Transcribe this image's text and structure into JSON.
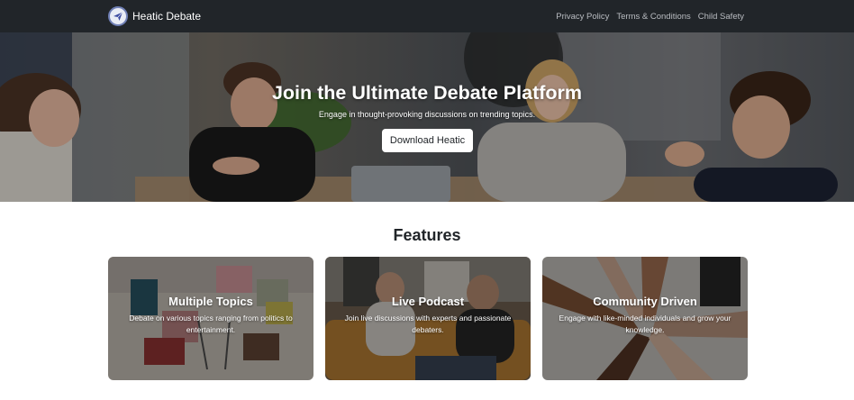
{
  "navbar": {
    "brand": "Heatic Debate",
    "logo_icon": "paper-plane-icon",
    "links": [
      "Privacy Policy",
      "Terms & Conditions",
      "Child Safety"
    ]
  },
  "hero": {
    "title": "Join the Ultimate Debate Platform",
    "subtitle": "Engage in thought-provoking discussions on trending topics.",
    "button": "Download Heatic"
  },
  "features": {
    "title": "Features",
    "cards": [
      {
        "title": "Multiple Topics",
        "text": "Debate on various topics ranging from politics to entertainment."
      },
      {
        "title": "Live Podcast",
        "text": "Join live discussions with experts and passionate debaters."
      },
      {
        "title": "Community Driven",
        "text": "Engage with like-minded individuals and grow your knowledge."
      }
    ]
  },
  "colors": {
    "navbar_bg": "#212529",
    "nav_link": "#b9bcc1",
    "button_bg": "#ffffff",
    "heading": "#212529"
  }
}
